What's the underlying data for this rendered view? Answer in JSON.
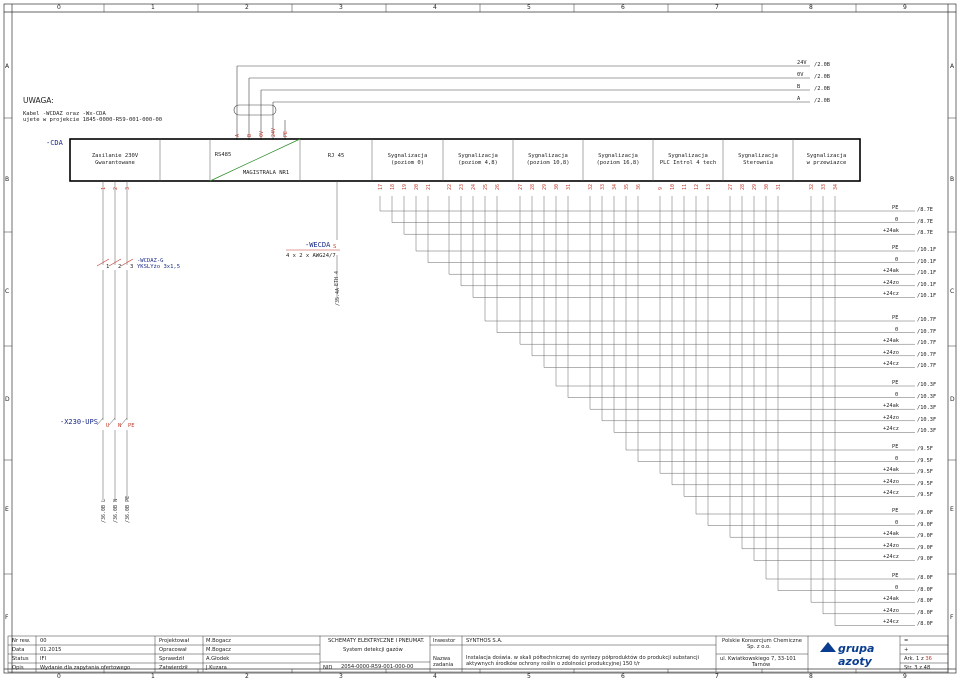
{
  "columns": [
    "0",
    "1",
    "2",
    "3",
    "4",
    "5",
    "6",
    "7",
    "8",
    "9"
  ],
  "rows": [
    "A",
    "B",
    "C",
    "D",
    "E",
    "F"
  ],
  "note": {
    "title": "UWAGA:",
    "line1": "Kabel -WCDAZ oraz -Wx-CDA",
    "line2": "ujete w projekcie 1845-0000-R59-001-000-00"
  },
  "power_refs": [
    {
      "label": "24V",
      "ref": "/2.0B"
    },
    {
      "label": "0V",
      "ref": "/2.0B"
    },
    {
      "label": "B",
      "ref": "/2.0B"
    },
    {
      "label": "A",
      "ref": "/2.0B"
    }
  ],
  "top_pins": [
    "A",
    "B",
    "0V",
    "24V",
    "PE"
  ],
  "device": {
    "tag": "-CDA",
    "sections": [
      {
        "label": "Zasilanie 230V\nGwarantowane"
      },
      {
        "label": "RS485"
      },
      {
        "label": "MAGISTRALA NR1"
      },
      {
        "label": "RJ 45"
      },
      {
        "label": "Sygnalizacja\n(poziom 0)"
      },
      {
        "label": "Sygnalizacja\n(poziom 4,8)"
      },
      {
        "label": "Sygnalizacja\n(poziom 10,8)"
      },
      {
        "label": "Sygnalizacja\n(poziom 16,8)"
      },
      {
        "label": "Sygnalizacja\nPLC Introl 4 tech"
      },
      {
        "label": "Sygnalizacja\nSterownia"
      },
      {
        "label": "Sygnalizacja\nw przewiazce"
      }
    ],
    "bottom_pins_left": [
      "1",
      "2",
      "3"
    ],
    "bottom_pins": [
      "17",
      "18",
      "19",
      "20",
      "21",
      "22",
      "23",
      "24",
      "25",
      "26",
      "27",
      "28",
      "29",
      "30",
      "31",
      "32",
      "33",
      "34",
      "35",
      "36",
      "9",
      "10",
      "11",
      "12",
      "13",
      "27",
      "28",
      "29",
      "30",
      "31",
      "32",
      "33",
      "34"
    ]
  },
  "cable_wcdaz_g": {
    "tag": "-WCDAZ-G",
    "spec": "YKSLYżo 3x1,5",
    "cores": [
      "1",
      "2",
      "3"
    ]
  },
  "cable_wecda": {
    "tag": "-WECDA",
    "suffix": "S",
    "spec": "4 x 2 x AWG24/7",
    "eth": "ETH 4",
    "ref": "/35.4A"
  },
  "ups": {
    "tag": "-X230-UPS",
    "terminals": [
      "U",
      "N",
      "PE"
    ],
    "refs": [
      "/36.0B",
      "/36.0B",
      "/36.0B"
    ],
    "ref_labels": [
      "L",
      "N",
      "PE"
    ]
  },
  "ref_groups": [
    {
      "rows": [
        {
          "label": "PE",
          "ref": "/8.7E"
        },
        {
          "label": "0",
          "ref": "/8.7E"
        },
        {
          "label": "+24ak",
          "ref": "/8.7E"
        }
      ]
    },
    {
      "rows": [
        {
          "label": "PE",
          "ref": "/10.1F"
        },
        {
          "label": "0",
          "ref": "/10.1F"
        },
        {
          "label": "+24ak",
          "ref": "/10.1F"
        },
        {
          "label": "+24zo",
          "ref": "/10.1F"
        },
        {
          "label": "+24cz",
          "ref": "/10.1F"
        }
      ]
    },
    {
      "rows": [
        {
          "label": "PE",
          "ref": "/10.7F"
        },
        {
          "label": "0",
          "ref": "/10.7F"
        },
        {
          "label": "+24ak",
          "ref": "/10.7F"
        },
        {
          "label": "+24zo",
          "ref": "/10.7F"
        },
        {
          "label": "+24cz",
          "ref": "/10.7F"
        }
      ]
    },
    {
      "rows": [
        {
          "label": "PE",
          "ref": "/10.3F"
        },
        {
          "label": "0",
          "ref": "/10.3F"
        },
        {
          "label": "+24ak",
          "ref": "/10.3F"
        },
        {
          "label": "+24zo",
          "ref": "/10.3F"
        },
        {
          "label": "+24cz",
          "ref": "/10.3F"
        }
      ]
    },
    {
      "rows": [
        {
          "label": "PE",
          "ref": "/9.5F"
        },
        {
          "label": "0",
          "ref": "/9.5F"
        },
        {
          "label": "+24ak",
          "ref": "/9.5F"
        },
        {
          "label": "+24zo",
          "ref": "/9.5F"
        },
        {
          "label": "+24cz",
          "ref": "/9.5F"
        }
      ]
    },
    {
      "rows": [
        {
          "label": "PE",
          "ref": "/9.0F"
        },
        {
          "label": "0",
          "ref": "/9.0F"
        },
        {
          "label": "+24ak",
          "ref": "/9.0F"
        },
        {
          "label": "+24zo",
          "ref": "/9.0F"
        },
        {
          "label": "+24cz",
          "ref": "/9.0F"
        }
      ]
    },
    {
      "rows": [
        {
          "label": "PE",
          "ref": "/8.0F"
        },
        {
          "label": "0",
          "ref": "/8.0F"
        },
        {
          "label": "+24ak",
          "ref": "/8.0F"
        },
        {
          "label": "+24zo",
          "ref": "/8.0F"
        },
        {
          "label": "+24cz",
          "ref": "/8.0F"
        }
      ]
    }
  ],
  "title_block": {
    "nr_rew_label": "Nr rew.",
    "nr_rew": "00",
    "data_label": "Data",
    "data": "01.2015",
    "status_label": "Status",
    "status": "IFI",
    "opis_label": "Opis",
    "opis": "Wydanie dla zapytania ofertowego",
    "projektowal_label": "Projektował",
    "projektowal": "M.Bogacz",
    "opracowal_label": "Opracował",
    "opracowal": "M.Bogacz",
    "sprawdzil_label": "Sprawdził",
    "sprawdzil": "A.Głodek",
    "zatwierdzil_label": "Zatwierdził",
    "zatwierdzil": "J.Kuzara",
    "doc_title": "SCHEMATY ELEKTRYCZNE I PNEUMAT.",
    "doc_subtitle": "System detekcji gazów",
    "nid_label": "NID",
    "nid": "2054-0000-R59-001-000-00",
    "investor_label": "Inwestor",
    "investor": "SYNTHOS S.A.",
    "task_label": "Nazwa zadania",
    "task": "Instalacja doświa. w skali półtechnicznej do syntezy półproduktów do produkcji substancji aktywnych środków ochrony roślin o zdolności produkcyjnej 150 t/r",
    "company1": "Polskie Konsorcjum Chemiczne",
    "company2": "Sp. z o.o.",
    "address1": "ul. Kwiatkowskiego 7, 33-101",
    "address2": "Tarnów",
    "logo": "grupa azoty",
    "ark_label": "Ark.",
    "ark_value": "1",
    "ark_of": "z",
    "ark_total": "36",
    "str_label": "Str.",
    "str_value": "3",
    "str_of": "z",
    "str_total": "48",
    "plus1": "+",
    "plus2": "+",
    "eq": "="
  }
}
